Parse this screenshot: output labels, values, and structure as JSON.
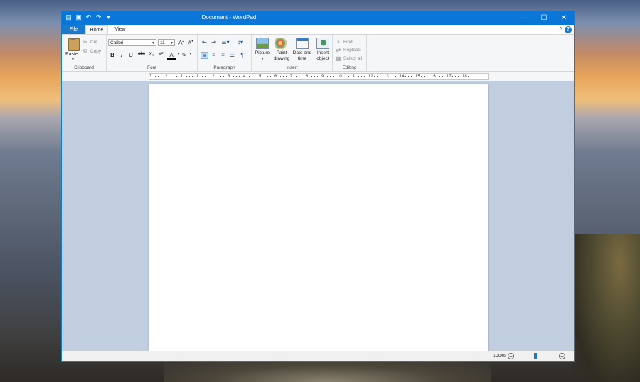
{
  "window": {
    "title": "Document - WordPad"
  },
  "qat": {
    "icons": [
      "wordpad-icon",
      "save-icon",
      "undo-icon",
      "redo-icon",
      "customize-icon"
    ]
  },
  "tabs": [
    {
      "label": "File"
    },
    {
      "label": "Home"
    },
    {
      "label": "View"
    }
  ],
  "clipboard": {
    "group_label": "Clipboard",
    "paste": "Paste",
    "cut": "Cut",
    "copy": "Copy"
  },
  "font": {
    "group_label": "Font",
    "family": "Calibri",
    "size": "11",
    "bold": "B",
    "italic": "I",
    "underline": "U",
    "strike": "abc",
    "subscript": "X₂",
    "superscript": "X²",
    "grow": "A",
    "shrink": "A",
    "color": "A"
  },
  "paragraph": {
    "group_label": "Paragraph"
  },
  "insert": {
    "group_label": "Insert",
    "picture": "Picture",
    "paint_l1": "Paint",
    "paint_l2": "drawing",
    "date_l1": "Date and",
    "date_l2": "time",
    "object_l1": "Insert",
    "object_l2": "object"
  },
  "editing": {
    "group_label": "Editing",
    "find": "Find",
    "replace": "Replace",
    "select_all": "Select all"
  },
  "ruler": {
    "labels": [
      "3",
      "2",
      "1",
      "1",
      "2",
      "3",
      "4",
      "5",
      "6",
      "7",
      "8",
      "9",
      "10",
      "11",
      "12",
      "13",
      "14",
      "15",
      "16",
      "17",
      "18"
    ]
  },
  "status": {
    "zoom": "100%"
  },
  "colors": {
    "accent": "#1979ca",
    "titlebar": "#0a76d8",
    "doc_background": "#c1cee0"
  }
}
